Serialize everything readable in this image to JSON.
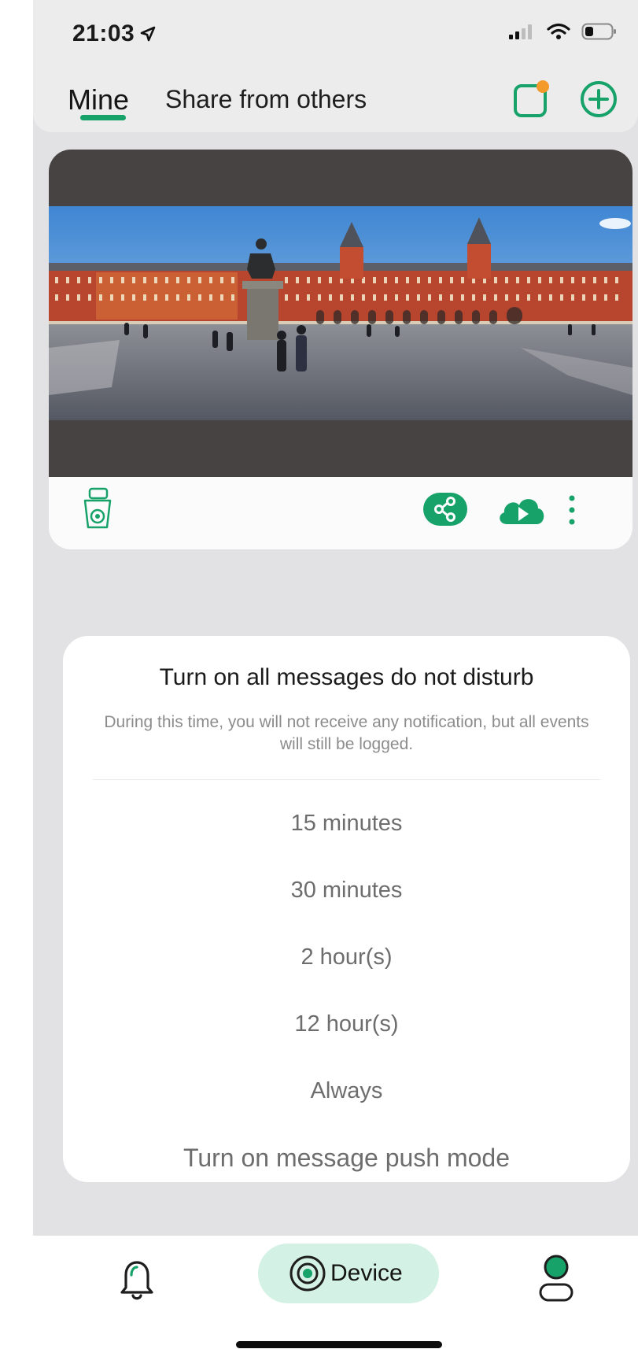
{
  "status_bar": {
    "time": "21:03",
    "location_icon": "location-arrow-icon",
    "signal_icon": "cellular-signal-icon",
    "wifi_icon": "wifi-icon",
    "battery_icon": "battery-icon"
  },
  "header": {
    "tabs": [
      {
        "label": "Mine",
        "active": true
      },
      {
        "label": "Share from others",
        "active": false
      }
    ],
    "actions": [
      {
        "icon": "message-notification-icon",
        "has_badge": true,
        "badge_color": "#f39a2b"
      },
      {
        "icon": "add-circle-icon"
      }
    ]
  },
  "camera_card": {
    "preview_icon": "camera-preview-image",
    "device_icon": "ptz-camera-icon",
    "toolbar_icons": [
      "share-icon",
      "cloud-playback-icon",
      "more-vertical-icon"
    ]
  },
  "dnd_dialog": {
    "title": "Turn on all messages do not disturb",
    "description": "During this time, you will not receive any notification, but all events will still be logged.",
    "options": [
      "15 minutes",
      "30 minutes",
      "2 hour(s)",
      "12 hour(s)",
      "Always",
      "Turn on message push mode"
    ]
  },
  "bottom_nav": {
    "items": [
      {
        "icon": "bell-icon",
        "label": ""
      },
      {
        "icon": "device-icon",
        "label": "Device",
        "active": true
      },
      {
        "icon": "profile-icon",
        "label": ""
      }
    ]
  },
  "colors": {
    "accent": "#17a26a",
    "active_tab_pill": "#d4f1e5",
    "badge": "#f39a2b",
    "background": "#e2e2e4"
  }
}
